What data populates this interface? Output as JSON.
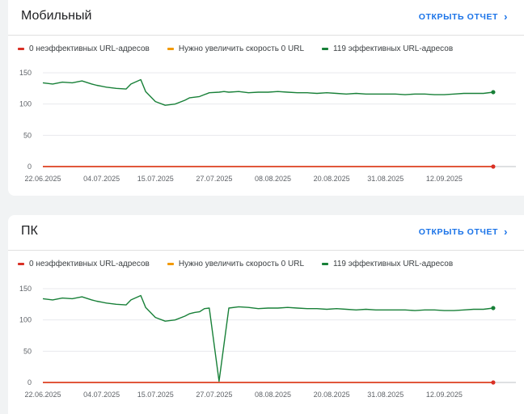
{
  "cards": [
    {
      "title": "Мобильный",
      "open_report_label": "ОТКРЫТЬ ОТЧЕТ",
      "legend": [
        {
          "label": "0 неэффективных URL-адресов",
          "color": "#d93025"
        },
        {
          "label": "Нужно увеличить скорость 0 URL",
          "color": "#f29900"
        },
        {
          "label": "119 эффективных URL-адресов",
          "color": "#188038"
        }
      ]
    },
    {
      "title": "ПК",
      "open_report_label": "ОТКРЫТЬ ОТЧЕТ",
      "legend": [
        {
          "label": "0 неэффективных URL-адресов",
          "color": "#d93025"
        },
        {
          "label": "Нужно увеличить скорость 0 URL",
          "color": "#f29900"
        },
        {
          "label": "119 эффективных URL-адресов",
          "color": "#188038"
        }
      ]
    }
  ],
  "chart_data": [
    {
      "type": "line",
      "ylim": [
        0,
        150
      ],
      "yticks": [
        0,
        50,
        100,
        150
      ],
      "grid": true,
      "xlim": [
        "2025-06-22",
        "2025-09-23"
      ],
      "xticks": [
        "22.06.2025",
        "04.07.2025",
        "15.07.2025",
        "27.07.2025",
        "08.08.2025",
        "20.08.2025",
        "31.08.2025",
        "12.09.2025"
      ],
      "x": [
        "2025-06-22",
        "2025-06-24",
        "2025-06-26",
        "2025-06-28",
        "2025-06-30",
        "2025-07-02",
        "2025-07-03",
        "2025-07-05",
        "2025-07-07",
        "2025-07-09",
        "2025-07-10",
        "2025-07-12",
        "2025-07-13",
        "2025-07-15",
        "2025-07-17",
        "2025-07-19",
        "2025-07-21",
        "2025-07-22",
        "2025-07-24",
        "2025-07-26",
        "2025-07-28",
        "2025-07-29",
        "2025-07-30",
        "2025-08-01",
        "2025-08-03",
        "2025-08-05",
        "2025-08-07",
        "2025-08-09",
        "2025-08-11",
        "2025-08-13",
        "2025-08-15",
        "2025-08-17",
        "2025-08-19",
        "2025-08-21",
        "2025-08-23",
        "2025-08-25",
        "2025-08-27",
        "2025-08-29",
        "2025-08-31",
        "2025-09-02",
        "2025-09-04",
        "2025-09-06",
        "2025-09-08",
        "2025-09-10",
        "2025-09-12",
        "2025-09-14",
        "2025-09-16",
        "2025-09-18",
        "2025-09-20",
        "2025-09-22"
      ],
      "series": [
        {
          "name": "0 неэффективных URL-адресов",
          "color": "#d93025",
          "values": [
            0,
            0,
            0,
            0,
            0,
            0,
            0,
            0,
            0,
            0,
            0,
            0,
            0,
            0,
            0,
            0,
            0,
            0,
            0,
            0,
            0,
            0,
            0,
            0,
            0,
            0,
            0,
            0,
            0,
            0,
            0,
            0,
            0,
            0,
            0,
            0,
            0,
            0,
            0,
            0,
            0,
            0,
            0,
            0,
            0,
            0,
            0,
            0,
            0,
            0
          ]
        },
        {
          "name": "Нужно увеличить скорость 0 URL",
          "color": "#f29900",
          "values": [
            0,
            0,
            0,
            0,
            0,
            0,
            0,
            0,
            0,
            0,
            0,
            0,
            0,
            0,
            0,
            0,
            0,
            0,
            0,
            0,
            0,
            0,
            0,
            0,
            0,
            0,
            0,
            0,
            0,
            0,
            0,
            0,
            0,
            0,
            0,
            0,
            0,
            0,
            0,
            0,
            0,
            0,
            0,
            0,
            0,
            0,
            0,
            0,
            0,
            0
          ]
        },
        {
          "name": "119 эффективных URL-адресов",
          "color": "#188038",
          "values": [
            134,
            132,
            135,
            134,
            137,
            132,
            130,
            127,
            125,
            124,
            132,
            139,
            120,
            104,
            98,
            100,
            106,
            110,
            112,
            118,
            119,
            120,
            119,
            120,
            118,
            119,
            119,
            120,
            119,
            118,
            118,
            117,
            118,
            117,
            116,
            117,
            116,
            116,
            116,
            116,
            115,
            116,
            116,
            115,
            115,
            116,
            117,
            117,
            117,
            119
          ]
        }
      ]
    },
    {
      "type": "line",
      "ylim": [
        0,
        150
      ],
      "yticks": [
        0,
        50,
        100,
        150
      ],
      "grid": true,
      "xlim": [
        "2025-06-22",
        "2025-09-23"
      ],
      "xticks": [
        "22.06.2025",
        "04.07.2025",
        "15.07.2025",
        "27.07.2025",
        "08.08.2025",
        "20.08.2025",
        "31.08.2025",
        "12.09.2025"
      ],
      "x": [
        "2025-06-22",
        "2025-06-24",
        "2025-06-26",
        "2025-06-28",
        "2025-06-30",
        "2025-07-02",
        "2025-07-03",
        "2025-07-05",
        "2025-07-07",
        "2025-07-09",
        "2025-07-10",
        "2025-07-12",
        "2025-07-13",
        "2025-07-15",
        "2025-07-17",
        "2025-07-19",
        "2025-07-21",
        "2025-07-22",
        "2025-07-23",
        "2025-07-24",
        "2025-07-25",
        "2025-07-26",
        "2025-07-28",
        "2025-07-30",
        "2025-08-01",
        "2025-08-03",
        "2025-08-05",
        "2025-08-07",
        "2025-08-09",
        "2025-08-11",
        "2025-08-13",
        "2025-08-15",
        "2025-08-17",
        "2025-08-19",
        "2025-08-21",
        "2025-08-23",
        "2025-08-25",
        "2025-08-27",
        "2025-08-29",
        "2025-08-31",
        "2025-09-02",
        "2025-09-04",
        "2025-09-06",
        "2025-09-08",
        "2025-09-10",
        "2025-09-12",
        "2025-09-14",
        "2025-09-16",
        "2025-09-18",
        "2025-09-20",
        "2025-09-22"
      ],
      "series": [
        {
          "name": "0 неэффективных URL-адресов",
          "color": "#d93025",
          "values": [
            0,
            0,
            0,
            0,
            0,
            0,
            0,
            0,
            0,
            0,
            0,
            0,
            0,
            0,
            0,
            0,
            0,
            0,
            0,
            0,
            0,
            0,
            0,
            0,
            0,
            0,
            0,
            0,
            0,
            0,
            0,
            0,
            0,
            0,
            0,
            0,
            0,
            0,
            0,
            0,
            0,
            0,
            0,
            0,
            0,
            0,
            0,
            0,
            0,
            0,
            0
          ]
        },
        {
          "name": "Нужно увеличить скорость 0 URL",
          "color": "#f29900",
          "values": [
            0,
            0,
            0,
            0,
            0,
            0,
            0,
            0,
            0,
            0,
            0,
            0,
            0,
            0,
            0,
            0,
            0,
            0,
            0,
            0,
            0,
            0,
            0,
            0,
            0,
            0,
            0,
            0,
            0,
            0,
            0,
            0,
            0,
            0,
            0,
            0,
            0,
            0,
            0,
            0,
            0,
            0,
            0,
            0,
            0,
            0,
            0,
            0,
            0,
            0,
            0
          ]
        },
        {
          "name": "119 эффективных URL-адресов",
          "color": "#188038",
          "values": [
            134,
            132,
            135,
            134,
            137,
            132,
            130,
            127,
            125,
            124,
            132,
            139,
            120,
            104,
            98,
            100,
            106,
            110,
            112,
            113,
            118,
            119,
            2,
            119,
            121,
            120,
            118,
            119,
            119,
            120,
            119,
            118,
            118,
            117,
            118,
            117,
            116,
            117,
            116,
            116,
            116,
            116,
            115,
            116,
            116,
            115,
            115,
            116,
            117,
            117,
            119
          ]
        }
      ]
    }
  ]
}
